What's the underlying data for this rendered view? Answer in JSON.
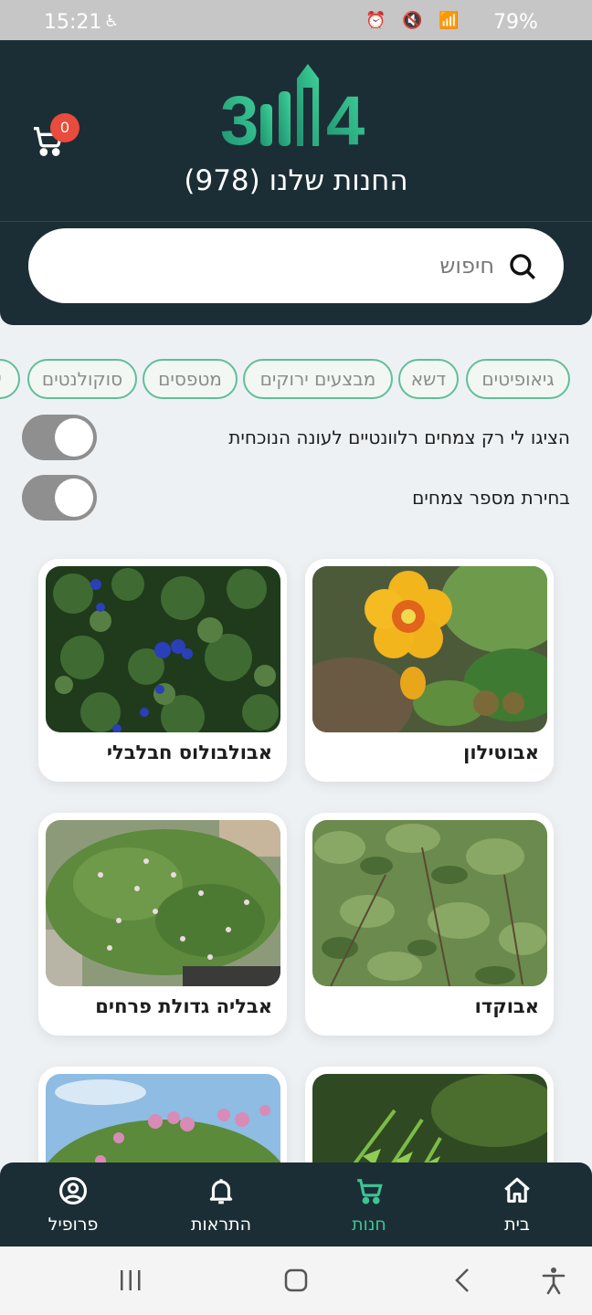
{
  "status_bar": {
    "time": "15:21",
    "battery": "79%"
  },
  "header": {
    "logo_text": "3ווו4",
    "store_title": "החנות שלנו (978)",
    "cart_count": "0"
  },
  "search": {
    "placeholder": "חיפוש"
  },
  "categories": [
    "גיאופיטים",
    "דשא",
    "מבצעים ירוקים",
    "מטפסים",
    "סוקולנטים"
  ],
  "filters": {
    "seasonal_label": "הציגו לי רק צמחים רלוונטיים לעונה הנוכחית",
    "count_label": "בחירת מספר צמחים"
  },
  "products": [
    {
      "name": "אבוטילון"
    },
    {
      "name": "אבולבולוס חבלבלי"
    },
    {
      "name": "אבוקדו"
    },
    {
      "name": "אבליה גדולת פרחים"
    },
    {
      "name": ""
    },
    {
      "name": ""
    }
  ],
  "bottom_nav": {
    "home": "בית",
    "store": "חנות",
    "notifications": "התראות",
    "profile": "פרופיל"
  },
  "colors": {
    "header_bg": "#1b2e35",
    "accent": "#3ec493",
    "badge": "#e94b3c",
    "chip_border": "#5fbf99"
  }
}
